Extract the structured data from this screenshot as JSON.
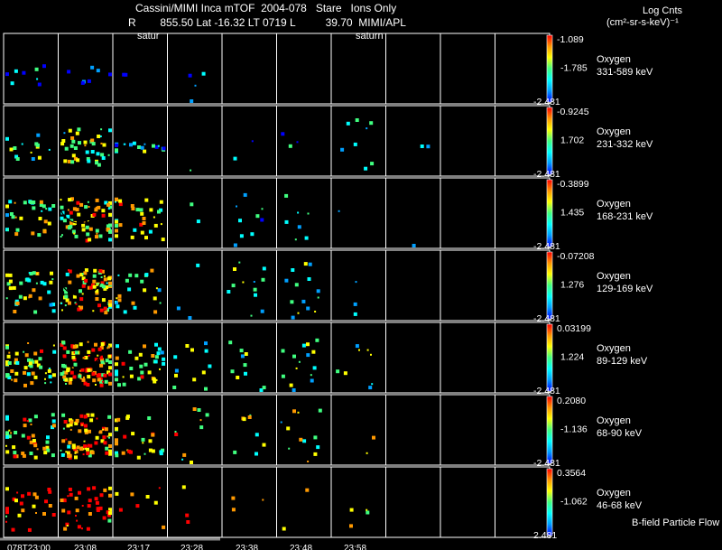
{
  "header": {
    "title": "Cassini/MIMI Inca mTOF  2004-078   Stare   Ions Only",
    "subtitle": "R        855.50 Lat -16.32 LT 0719 L          39.70  MIMI/APL",
    "colorbar_title_line1": "Log Cnts",
    "colorbar_title_line2": "(cm²-sr-s-keV)⁻¹"
  },
  "footer": {
    "flow_label": "B-field Particle Flow"
  },
  "chart_data": {
    "type": "heatmap",
    "columns_per_row": 10,
    "frame_labels": [
      {
        "column": 2,
        "text": "satur"
      },
      {
        "column": 6,
        "text": "saturn"
      }
    ],
    "time_ticks": [
      "078T23:00",
      "23:08",
      "23:17",
      "23:28",
      "23:38",
      "23:48",
      "23:58"
    ],
    "colormap": [
      "#0000ff",
      "#00a0ff",
      "#00ffff",
      "#40ff80",
      "#ffff00",
      "#ff9900",
      "#ff0000"
    ],
    "rows": [
      {
        "species": "Oxygen",
        "energy": "331-589 keV",
        "cbar_max": "-1.089",
        "cbar_mid": "-1.785",
        "cbar_min": "-2.481",
        "counts": [
          [
            8,
            40,
            0.05
          ],
          [
            7,
            25,
            0.1
          ],
          [
            2,
            1,
            0.1
          ],
          [
            4,
            0,
            0.05
          ],
          [
            0,
            0,
            0
          ],
          [
            0,
            0,
            0
          ],
          [
            0,
            0,
            0
          ],
          [
            0,
            0,
            0
          ],
          [
            0,
            0,
            0
          ],
          [
            0,
            0,
            0
          ]
        ]
      },
      {
        "species": "Oxygen",
        "energy": "231-332 keV",
        "cbar_max": "-0.9245",
        "cbar_mid": "1.702",
        "cbar_min": "-2.481",
        "counts": [
          [
            14,
            45,
            0.25
          ],
          [
            40,
            50,
            0.4
          ],
          [
            18,
            12,
            0.3
          ],
          [
            1,
            0,
            0.2
          ],
          [
            2,
            4,
            0.1
          ],
          [
            3,
            14,
            0.15
          ],
          [
            8,
            16,
            0.15
          ],
          [
            2,
            8,
            0.1
          ],
          [
            0,
            0,
            0
          ],
          [
            0,
            0,
            0
          ]
        ]
      },
      {
        "species": "Oxygen",
        "energy": "168-231 keV",
        "cbar_max": "-0.3899",
        "cbar_mid": "1.435",
        "cbar_min": "-2.481",
        "counts": [
          [
            32,
            50,
            0.4
          ],
          [
            70,
            60,
            0.55
          ],
          [
            34,
            60,
            0.5
          ],
          [
            2,
            4,
            0.2
          ],
          [
            9,
            40,
            0.2
          ],
          [
            7,
            20,
            0.2
          ],
          [
            1,
            0,
            0.2
          ],
          [
            1,
            0,
            0.2
          ],
          [
            0,
            0,
            0
          ],
          [
            0,
            0,
            0
          ]
        ]
      },
      {
        "species": "Oxygen",
        "energy": "129-169 keV",
        "cbar_max": "-0.07208",
        "cbar_mid": "1.276",
        "cbar_min": "-2.481",
        "counts": [
          [
            40,
            60,
            0.45
          ],
          [
            80,
            60,
            0.6
          ],
          [
            24,
            60,
            0.45
          ],
          [
            3,
            60,
            0.25
          ],
          [
            12,
            50,
            0.25
          ],
          [
            14,
            40,
            0.25
          ],
          [
            3,
            50,
            0.2
          ],
          [
            0,
            0,
            0
          ],
          [
            0,
            0,
            0
          ],
          [
            0,
            0,
            0
          ]
        ]
      },
      {
        "species": "Oxygen",
        "energy": "89-129 keV",
        "cbar_max": "0.03199",
        "cbar_mid": "1.224",
        "cbar_min": "-2.481",
        "counts": [
          [
            55,
            60,
            0.5
          ],
          [
            100,
            60,
            0.65
          ],
          [
            38,
            60,
            0.5
          ],
          [
            12,
            50,
            0.3
          ],
          [
            10,
            40,
            0.3
          ],
          [
            15,
            30,
            0.3
          ],
          [
            8,
            30,
            0.3
          ],
          [
            0,
            0,
            0
          ],
          [
            0,
            0,
            0
          ],
          [
            0,
            0,
            0
          ]
        ]
      },
      {
        "species": "Oxygen",
        "energy": "68-90 keV",
        "cbar_max": "0.2080",
        "cbar_mid": "-1.136",
        "cbar_min": "-2.481",
        "counts": [
          [
            45,
            60,
            0.55
          ],
          [
            80,
            60,
            0.65
          ],
          [
            30,
            60,
            0.55
          ],
          [
            10,
            50,
            0.5
          ],
          [
            8,
            40,
            0.4
          ],
          [
            12,
            30,
            0.4
          ],
          [
            2,
            30,
            0.4
          ],
          [
            0,
            0,
            0
          ],
          [
            0,
            0,
            0
          ],
          [
            0,
            0,
            0
          ]
        ]
      },
      {
        "species": "Oxygen",
        "energy": "46-68 keV",
        "cbar_max": "0.3564",
        "cbar_mid": "-1.062",
        "cbar_min": "2.481",
        "counts": [
          [
            25,
            60,
            0.75
          ],
          [
            40,
            60,
            0.8
          ],
          [
            8,
            60,
            0.75
          ],
          [
            3,
            60,
            0.7
          ],
          [
            3,
            30,
            0.5
          ],
          [
            2,
            10,
            0.5
          ],
          [
            4,
            10,
            0.5
          ],
          [
            0,
            0,
            0
          ],
          [
            0,
            0,
            0
          ],
          [
            0,
            0,
            0
          ]
        ]
      }
    ]
  }
}
